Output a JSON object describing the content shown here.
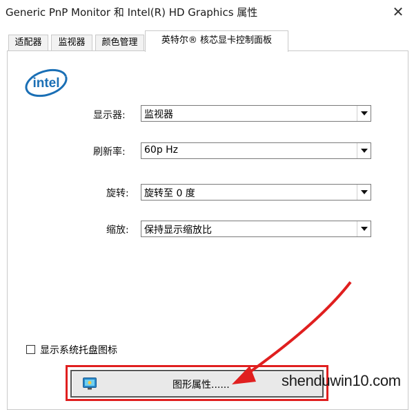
{
  "window": {
    "title": "Generic PnP Monitor 和 Intel(R) HD Graphics 属性",
    "close_glyph": "✕"
  },
  "tabs": [
    {
      "label": "适配器",
      "active": false
    },
    {
      "label": "监视器",
      "active": false
    },
    {
      "label": "颜色管理",
      "active": false
    },
    {
      "label": "英特尔® 核芯显卡控制面板",
      "active": true
    }
  ],
  "panel": {
    "logo_text": "intel",
    "fields": [
      {
        "label": "显示器:",
        "value": "监视器"
      },
      {
        "label": "刷新率:",
        "value": "60p Hz"
      },
      {
        "label": "旋转:",
        "value": "旋转至 0 度"
      },
      {
        "label": "缩放:",
        "value": "保持显示缩放比"
      }
    ],
    "tray_checkbox": {
      "label": "显示系统托盘图标",
      "checked": false
    },
    "graphics_button": {
      "label": "图形属性......",
      "icon": "display-settings-icon"
    }
  },
  "annotation": {
    "color": "#e01f1f"
  },
  "watermark": "shenduwin10.com",
  "colors": {
    "intel_blue": "#1a6fb5"
  }
}
